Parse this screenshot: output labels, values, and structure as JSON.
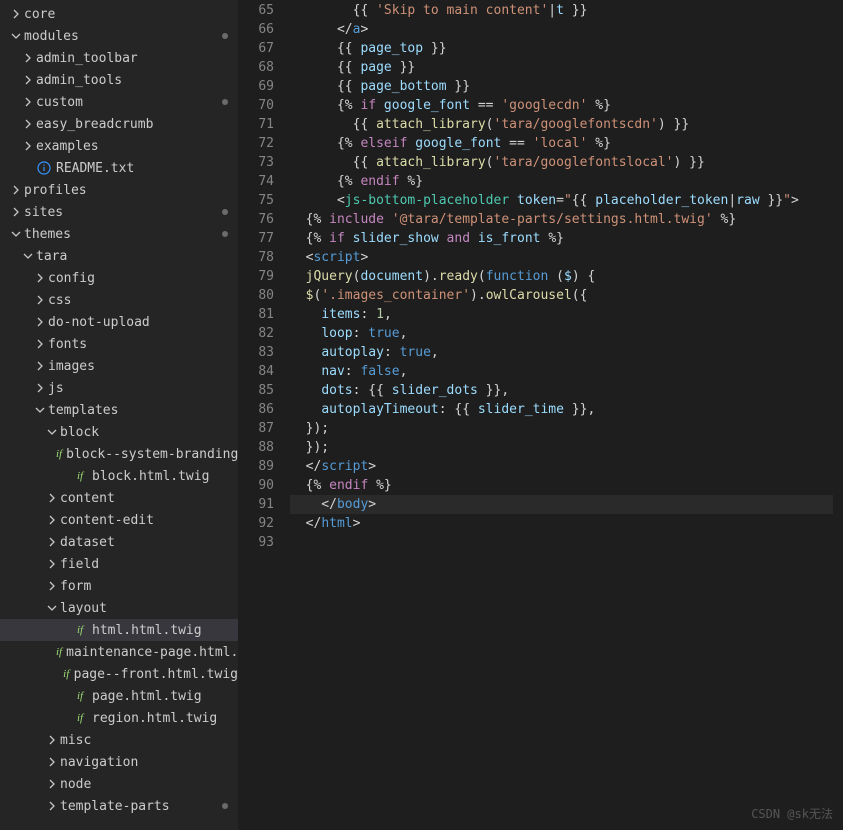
{
  "watermark": "CSDN @sk无法",
  "sidebar": {
    "items": [
      {
        "depth": 0,
        "type": "folder",
        "open": false,
        "label": "core",
        "modified": false
      },
      {
        "depth": 0,
        "type": "folder",
        "open": true,
        "label": "modules",
        "modified": true
      },
      {
        "depth": 1,
        "type": "folder",
        "open": false,
        "label": "admin_toolbar",
        "modified": false
      },
      {
        "depth": 1,
        "type": "folder",
        "open": false,
        "label": "admin_tools",
        "modified": false
      },
      {
        "depth": 1,
        "type": "folder",
        "open": false,
        "label": "custom",
        "modified": true
      },
      {
        "depth": 1,
        "type": "folder",
        "open": false,
        "label": "easy_breadcrumb",
        "modified": false
      },
      {
        "depth": 1,
        "type": "folder",
        "open": false,
        "label": "examples",
        "modified": false
      },
      {
        "depth": 1,
        "type": "file",
        "icon": "info",
        "label": "README.txt",
        "modified": false
      },
      {
        "depth": 0,
        "type": "folder",
        "open": false,
        "label": "profiles",
        "modified": false
      },
      {
        "depth": 0,
        "type": "folder",
        "open": false,
        "label": "sites",
        "modified": true
      },
      {
        "depth": 0,
        "type": "folder",
        "open": true,
        "label": "themes",
        "modified": true
      },
      {
        "depth": 1,
        "type": "folder",
        "open": true,
        "label": "tara",
        "modified": false
      },
      {
        "depth": 2,
        "type": "folder",
        "open": false,
        "label": "config",
        "modified": false
      },
      {
        "depth": 2,
        "type": "folder",
        "open": false,
        "label": "css",
        "modified": false
      },
      {
        "depth": 2,
        "type": "folder",
        "open": false,
        "label": "do-not-upload",
        "modified": false
      },
      {
        "depth": 2,
        "type": "folder",
        "open": false,
        "label": "fonts",
        "modified": false
      },
      {
        "depth": 2,
        "type": "folder",
        "open": false,
        "label": "images",
        "modified": false
      },
      {
        "depth": 2,
        "type": "folder",
        "open": false,
        "label": "js",
        "modified": false
      },
      {
        "depth": 2,
        "type": "folder",
        "open": true,
        "label": "templates",
        "modified": false
      },
      {
        "depth": 3,
        "type": "folder",
        "open": true,
        "label": "block",
        "modified": false
      },
      {
        "depth": 4,
        "type": "file",
        "icon": "twig",
        "label": "block--system-branding-blo...",
        "modified": false
      },
      {
        "depth": 4,
        "type": "file",
        "icon": "twig",
        "label": "block.html.twig",
        "modified": false
      },
      {
        "depth": 3,
        "type": "folder",
        "open": false,
        "label": "content",
        "modified": false
      },
      {
        "depth": 3,
        "type": "folder",
        "open": false,
        "label": "content-edit",
        "modified": false
      },
      {
        "depth": 3,
        "type": "folder",
        "open": false,
        "label": "dataset",
        "modified": false
      },
      {
        "depth": 3,
        "type": "folder",
        "open": false,
        "label": "field",
        "modified": false
      },
      {
        "depth": 3,
        "type": "folder",
        "open": false,
        "label": "form",
        "modified": false
      },
      {
        "depth": 3,
        "type": "folder",
        "open": true,
        "label": "layout",
        "modified": false
      },
      {
        "depth": 4,
        "type": "file",
        "icon": "twig",
        "label": "html.html.twig",
        "modified": false,
        "selected": true
      },
      {
        "depth": 4,
        "type": "file",
        "icon": "twig",
        "label": "maintenance-page.html.twig",
        "modified": false
      },
      {
        "depth": 4,
        "type": "file",
        "icon": "twig",
        "label": "page--front.html.twig",
        "modified": false
      },
      {
        "depth": 4,
        "type": "file",
        "icon": "twig",
        "label": "page.html.twig",
        "modified": false
      },
      {
        "depth": 4,
        "type": "file",
        "icon": "twig",
        "label": "region.html.twig",
        "modified": false
      },
      {
        "depth": 3,
        "type": "folder",
        "open": false,
        "label": "misc",
        "modified": false
      },
      {
        "depth": 3,
        "type": "folder",
        "open": false,
        "label": "navigation",
        "modified": false
      },
      {
        "depth": 3,
        "type": "folder",
        "open": false,
        "label": "node",
        "modified": false
      },
      {
        "depth": 3,
        "type": "folder",
        "open": false,
        "label": "template-parts",
        "modified": true
      }
    ]
  },
  "editor": {
    "startLine": 65,
    "currentLine": 91,
    "lines": [
      [
        {
          "t": "        {{ ",
          "c": "twig-delim"
        },
        {
          "t": "'Skip to main content'",
          "c": "str"
        },
        {
          "t": "|",
          "c": "d0"
        },
        {
          "t": "t",
          "c": "twig-var"
        },
        {
          "t": " }}",
          "c": "twig-delim"
        }
      ],
      [
        {
          "t": "      </",
          "c": "d0"
        },
        {
          "t": "a",
          "c": "kw"
        },
        {
          "t": ">",
          "c": "d0"
        }
      ],
      [
        {
          "t": "      {{ ",
          "c": "twig-delim"
        },
        {
          "t": "page_top",
          "c": "twig-var"
        },
        {
          "t": " }}",
          "c": "twig-delim"
        }
      ],
      [
        {
          "t": "      {{ ",
          "c": "twig-delim"
        },
        {
          "t": "page",
          "c": "twig-var"
        },
        {
          "t": " }}",
          "c": "twig-delim"
        }
      ],
      [
        {
          "t": "      {{ ",
          "c": "twig-delim"
        },
        {
          "t": "page_bottom",
          "c": "twig-var"
        },
        {
          "t": " }}",
          "c": "twig-delim"
        }
      ],
      [
        {
          "t": "      {% ",
          "c": "twig-delim"
        },
        {
          "t": "if",
          "c": "twig-kw"
        },
        {
          "t": " google_font ",
          "c": "twig-var"
        },
        {
          "t": "==",
          "c": "d0"
        },
        {
          "t": " 'googlecdn'",
          "c": "str"
        },
        {
          "t": " %}",
          "c": "twig-delim"
        }
      ],
      [
        {
          "t": "        {{ ",
          "c": "twig-delim"
        },
        {
          "t": "attach_library",
          "c": "fn"
        },
        {
          "t": "(",
          "c": "d0"
        },
        {
          "t": "'tara/googlefontscdn'",
          "c": "str"
        },
        {
          "t": ")",
          "c": "d0"
        },
        {
          "t": " }}",
          "c": "twig-delim"
        }
      ],
      [
        {
          "t": "      {% ",
          "c": "twig-delim"
        },
        {
          "t": "elseif",
          "c": "twig-kw"
        },
        {
          "t": " google_font ",
          "c": "twig-var"
        },
        {
          "t": "==",
          "c": "d0"
        },
        {
          "t": " 'local'",
          "c": "str"
        },
        {
          "t": " %}",
          "c": "twig-delim"
        }
      ],
      [
        {
          "t": "        {{ ",
          "c": "twig-delim"
        },
        {
          "t": "attach_library",
          "c": "fn"
        },
        {
          "t": "(",
          "c": "d0"
        },
        {
          "t": "'tara/googlefontslocal'",
          "c": "str"
        },
        {
          "t": ")",
          "c": "d0"
        },
        {
          "t": " }}",
          "c": "twig-delim"
        }
      ],
      [
        {
          "t": "      {% ",
          "c": "twig-delim"
        },
        {
          "t": "endif",
          "c": "twig-kw"
        },
        {
          "t": " %}",
          "c": "twig-delim"
        }
      ],
      [
        {
          "t": "      <",
          "c": "d0"
        },
        {
          "t": "js-bottom-placeholder",
          "c": "tag"
        },
        {
          "t": " ",
          "c": "d0"
        },
        {
          "t": "token",
          "c": "attr"
        },
        {
          "t": "=",
          "c": "d0"
        },
        {
          "t": "\"",
          "c": "str"
        },
        {
          "t": "{{ ",
          "c": "twig-delim"
        },
        {
          "t": "placeholder_token",
          "c": "twig-var"
        },
        {
          "t": "|",
          "c": "d0"
        },
        {
          "t": "raw",
          "c": "twig-var"
        },
        {
          "t": " }}",
          "c": "twig-delim"
        },
        {
          "t": "\"",
          "c": "str"
        },
        {
          "t": ">",
          "c": "d0"
        }
      ],
      [
        {
          "t": "  {% ",
          "c": "twig-delim"
        },
        {
          "t": "include",
          "c": "twig-kw"
        },
        {
          "t": " '@tara/template-parts/settings.html.twig'",
          "c": "str"
        },
        {
          "t": " %}",
          "c": "twig-delim"
        }
      ],
      [
        {
          "t": "  {% ",
          "c": "twig-delim"
        },
        {
          "t": "if",
          "c": "twig-kw"
        },
        {
          "t": " slider_show ",
          "c": "twig-var"
        },
        {
          "t": "and",
          "c": "twig-kw"
        },
        {
          "t": " is_front ",
          "c": "twig-var"
        },
        {
          "t": "%}",
          "c": "twig-delim"
        }
      ],
      [
        {
          "t": "  <",
          "c": "d0"
        },
        {
          "t": "script",
          "c": "kw"
        },
        {
          "t": ">",
          "c": "d0"
        }
      ],
      [
        {
          "t": "  ",
          "c": "d0"
        },
        {
          "t": "jQuery",
          "c": "fn"
        },
        {
          "t": "(",
          "c": "d0"
        },
        {
          "t": "document",
          "c": "twig-var"
        },
        {
          "t": ").",
          "c": "d0"
        },
        {
          "t": "ready",
          "c": "fn"
        },
        {
          "t": "(",
          "c": "d0"
        },
        {
          "t": "function",
          "c": "kw"
        },
        {
          "t": " (",
          "c": "d0"
        },
        {
          "t": "$",
          "c": "twig-var"
        },
        {
          "t": ") {",
          "c": "d0"
        }
      ],
      [
        {
          "t": "  ",
          "c": "d0"
        },
        {
          "t": "$",
          "c": "fn"
        },
        {
          "t": "(",
          "c": "d0"
        },
        {
          "t": "'.images_container'",
          "c": "str"
        },
        {
          "t": ").",
          "c": "d0"
        },
        {
          "t": "owlCarousel",
          "c": "fn"
        },
        {
          "t": "({",
          "c": "d0"
        }
      ],
      [
        {
          "t": "    ",
          "c": "d0"
        },
        {
          "t": "items",
          "c": "attr"
        },
        {
          "t": ": ",
          "c": "d0"
        },
        {
          "t": "1",
          "c": "num"
        },
        {
          "t": ",",
          "c": "d0"
        }
      ],
      [
        {
          "t": "    ",
          "c": "d0"
        },
        {
          "t": "loop",
          "c": "attr"
        },
        {
          "t": ": ",
          "c": "d0"
        },
        {
          "t": "true",
          "c": "bool"
        },
        {
          "t": ",",
          "c": "d0"
        }
      ],
      [
        {
          "t": "    ",
          "c": "d0"
        },
        {
          "t": "autoplay",
          "c": "attr"
        },
        {
          "t": ": ",
          "c": "d0"
        },
        {
          "t": "true",
          "c": "bool"
        },
        {
          "t": ",",
          "c": "d0"
        }
      ],
      [
        {
          "t": "    ",
          "c": "d0"
        },
        {
          "t": "nav",
          "c": "attr"
        },
        {
          "t": ": ",
          "c": "d0"
        },
        {
          "t": "false",
          "c": "bool"
        },
        {
          "t": ",",
          "c": "d0"
        }
      ],
      [
        {
          "t": "    ",
          "c": "d0"
        },
        {
          "t": "dots",
          "c": "attr"
        },
        {
          "t": ": ",
          "c": "d0"
        },
        {
          "t": "{{ ",
          "c": "twig-delim"
        },
        {
          "t": "slider_dots",
          "c": "twig-var"
        },
        {
          "t": " }}",
          "c": "twig-delim"
        },
        {
          "t": ",",
          "c": "d0"
        }
      ],
      [
        {
          "t": "    ",
          "c": "d0"
        },
        {
          "t": "autoplayTimeout",
          "c": "attr"
        },
        {
          "t": ": ",
          "c": "d0"
        },
        {
          "t": "{{ ",
          "c": "twig-delim"
        },
        {
          "t": "slider_time",
          "c": "twig-var"
        },
        {
          "t": " }}",
          "c": "twig-delim"
        },
        {
          "t": ",",
          "c": "d0"
        }
      ],
      [
        {
          "t": "  });",
          "c": "d0"
        }
      ],
      [
        {
          "t": "  });",
          "c": "d0"
        }
      ],
      [
        {
          "t": "  </",
          "c": "d0"
        },
        {
          "t": "script",
          "c": "kw"
        },
        {
          "t": ">",
          "c": "d0"
        }
      ],
      [
        {
          "t": "  {% ",
          "c": "twig-delim"
        },
        {
          "t": "endif",
          "c": "twig-kw"
        },
        {
          "t": " %}",
          "c": "twig-delim"
        }
      ],
      [
        {
          "t": "    </",
          "c": "d0"
        },
        {
          "t": "body",
          "c": "kw"
        },
        {
          "t": ">",
          "c": "d0"
        }
      ],
      [
        {
          "t": "  </",
          "c": "d0"
        },
        {
          "t": "html",
          "c": "kw"
        },
        {
          "t": ">",
          "c": "d0"
        }
      ],
      []
    ]
  }
}
